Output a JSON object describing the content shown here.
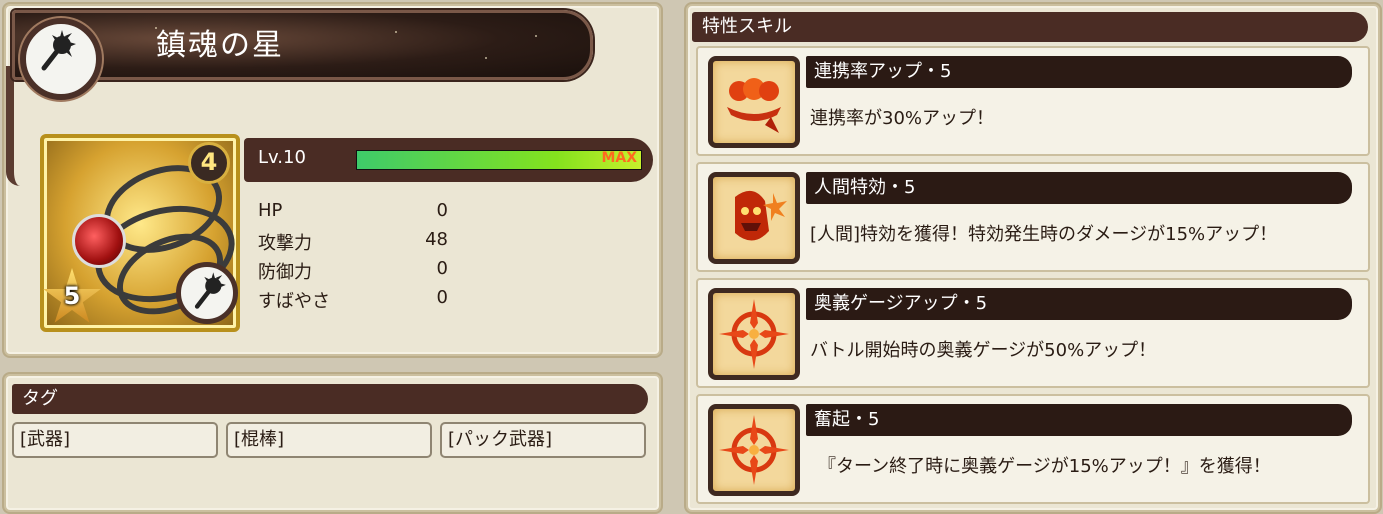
{
  "weapon": {
    "name": "鎮魂の星",
    "rarity_number": "4",
    "star_level": "5",
    "level_label": "Lv.10",
    "level_progress": 1.0,
    "level_max_text": "MAX",
    "stats": [
      {
        "name": "HP",
        "value": "0"
      },
      {
        "name": "攻撃力",
        "value": "48"
      },
      {
        "name": "防御力",
        "value": "0"
      },
      {
        "name": "すばやさ",
        "value": "0"
      }
    ],
    "type_icon": "mace-icon"
  },
  "tags": {
    "header": "タグ",
    "items": [
      "[武器]",
      "[棍棒]",
      "[パック武器]"
    ]
  },
  "skills": {
    "header": "特性スキル",
    "items": [
      {
        "name": "連携率アップ・5",
        "desc": "連携率が30%アップ！",
        "icon": "fist-bump-icon"
      },
      {
        "name": "人間特効・5",
        "desc": "[人間]特効を獲得！特効発生時のダメージが15%アップ！",
        "icon": "demon-burst-icon"
      },
      {
        "name": "奥義ゲージアップ・5",
        "desc": "バトル開始時の奥義ゲージが50%アップ！",
        "icon": "compass-burst-icon"
      },
      {
        "name": "奮起・5",
        "desc": "『ターン終了時に奥義ゲージが15%アップ！』を獲得！",
        "icon": "compass-burst-icon"
      }
    ]
  },
  "colors": {
    "panel_bg": "#ebe6d4",
    "header_bg": "#4a2c24",
    "level_fill": "#84e21e",
    "max_text": "#ff6a20"
  }
}
